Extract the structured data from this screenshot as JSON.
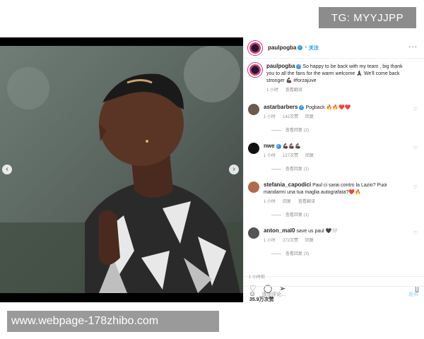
{
  "watermarks": {
    "top": "TG: MYYJJPP",
    "bottom": "www.webpage-178zhibo.com"
  },
  "header": {
    "username": "paulpogba",
    "follow_label": "关注",
    "more_label": "···"
  },
  "caption": {
    "username": "paulpogba",
    "text": "So happy to be back with my team , big thank you to all the fans for the warm welcome 🙏🏿 We'll come back stronger 💪🏿 #forzajuve",
    "time": "1 小时",
    "translate": "查看翻译"
  },
  "comments": [
    {
      "username": "astarbarbers",
      "text": "Pogback 🔥🔥❤️❤️",
      "time": "1 小时",
      "likes": "142次赞",
      "reply": "回复",
      "replies": "查看回复 (2)"
    },
    {
      "username": "nwe",
      "text": "💪🏿💪🏿💪🏿",
      "time": "1 小时",
      "likes": "127次赞",
      "reply": "回复",
      "replies": "查看回复 (1)"
    },
    {
      "username": "stefania_capodici",
      "text": "Paul ci sarai contro la Lazio? Puoi mandarmi una tua maglia autografata?❤️🔥",
      "time": "1 小时",
      "likes": "回复",
      "reply": "查看翻译",
      "replies": "查看回复 (1)"
    },
    {
      "username": "anton_mal0",
      "text": "save us paul 🖤🤍",
      "time": "1 小时",
      "likes": "272次赞",
      "reply": "回复",
      "replies": "查看回复 (3)"
    }
  ],
  "actions": {
    "like_icon": "heart-icon",
    "comment_icon": "comment-icon",
    "share_icon": "share-icon",
    "save_icon": "bookmark-icon",
    "likes": "35.9万次赞",
    "time": "1 小时前"
  },
  "add_comment": {
    "placeholder": "添加评论...",
    "post_label": "发布"
  },
  "colors": {
    "link": "#0095f6",
    "verified": "#3897f0",
    "muted": "#8e8e8e"
  }
}
